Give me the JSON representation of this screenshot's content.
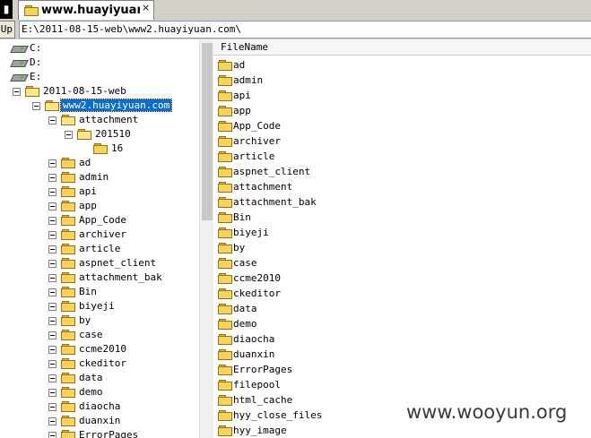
{
  "tab": {
    "title": "www.huayiyuan.c…",
    "close_label": "×"
  },
  "pathbar": {
    "up_label": "Up",
    "path": "E:\\2011-08-15-web\\www2.huayiyuan.com\\"
  },
  "tree": {
    "drives": [
      "C:",
      "D:",
      "E:"
    ],
    "nodes": [
      {
        "label": "2011-08-15-web",
        "level": 1
      },
      {
        "label": "www2.huayiyuan.com",
        "level": 2,
        "selected": true
      },
      {
        "label": "attachment",
        "level": 3
      },
      {
        "label": "201510",
        "level": 4
      },
      {
        "label": "16",
        "level": 5
      },
      {
        "label": "ad",
        "level": 3
      },
      {
        "label": "admin",
        "level": 3
      },
      {
        "label": "api",
        "level": 3
      },
      {
        "label": "app",
        "level": 3
      },
      {
        "label": "App_Code",
        "level": 3
      },
      {
        "label": "archiver",
        "level": 3
      },
      {
        "label": "article",
        "level": 3
      },
      {
        "label": "aspnet_client",
        "level": 3
      },
      {
        "label": "attachment_bak",
        "level": 3
      },
      {
        "label": "Bin",
        "level": 3
      },
      {
        "label": "biyeji",
        "level": 3
      },
      {
        "label": "by",
        "level": 3
      },
      {
        "label": "case",
        "level": 3
      },
      {
        "label": "ccme2010",
        "level": 3
      },
      {
        "label": "ckeditor",
        "level": 3
      },
      {
        "label": "data",
        "level": 3
      },
      {
        "label": "demo",
        "level": 3
      },
      {
        "label": "diaocha",
        "level": 3
      },
      {
        "label": "duanxin",
        "level": 3
      },
      {
        "label": "ErrorPages",
        "level": 3
      }
    ]
  },
  "list": {
    "header": "FileName",
    "items": [
      "ad",
      "admin",
      "api",
      "app",
      "App_Code",
      "archiver",
      "article",
      "aspnet_client",
      "attachment",
      "attachment_bak",
      "Bin",
      "biyeji",
      "by",
      "case",
      "ccme2010",
      "ckeditor",
      "data",
      "demo",
      "diaocha",
      "duanxin",
      "ErrorPages",
      "filepool",
      "html_cache",
      "hyy_close_files",
      "hyy_image"
    ]
  },
  "watermark": "www.wooyun.org"
}
